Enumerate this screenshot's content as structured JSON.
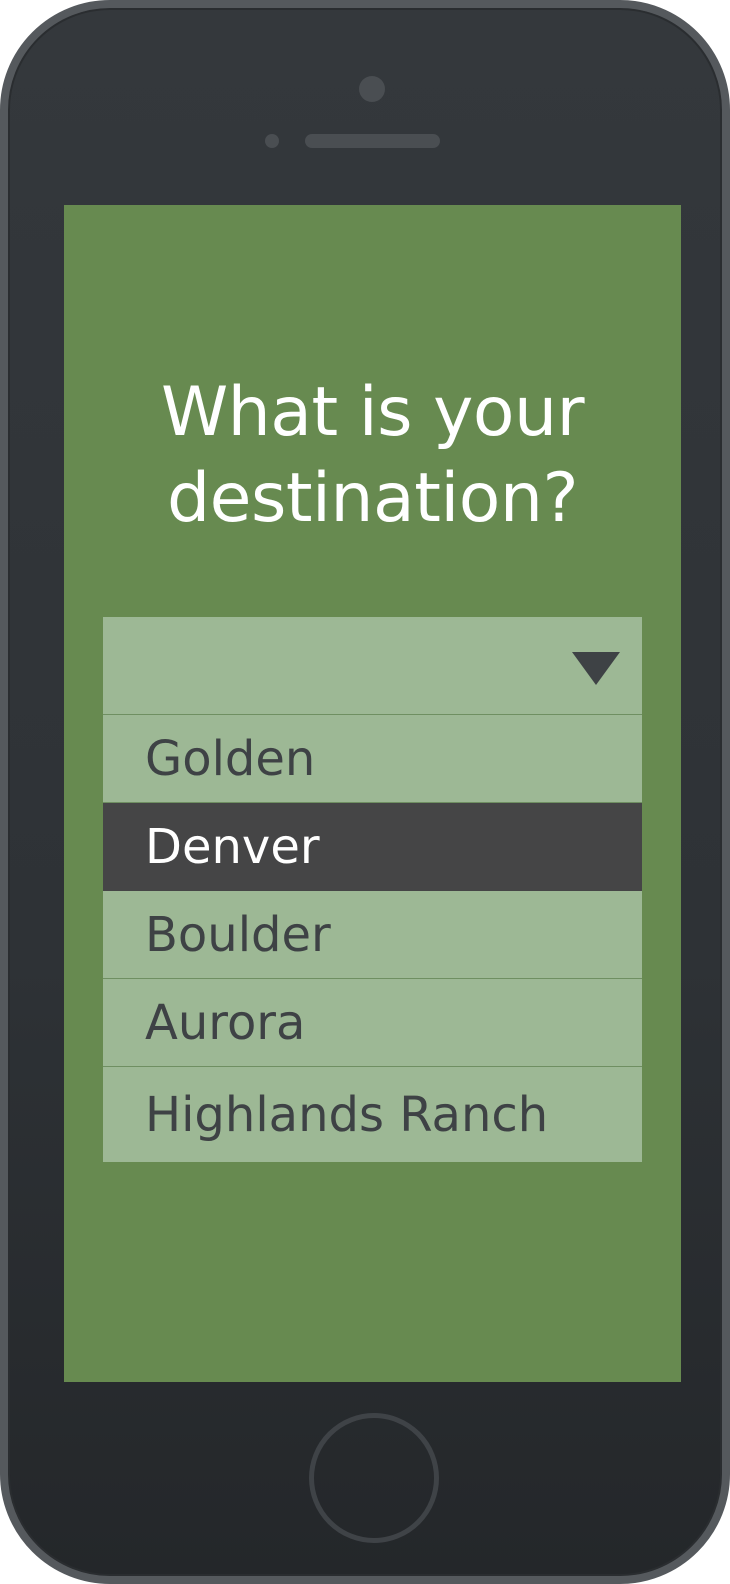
{
  "screen": {
    "question": "What is your destination?",
    "background_color": "#678a50"
  },
  "dropdown": {
    "selected_value": "",
    "options": [
      {
        "label": "Golden"
      },
      {
        "label": "Denver",
        "highlighted": true
      },
      {
        "label": "Boulder"
      },
      {
        "label": "Aurora"
      },
      {
        "label": "Highlands Ranch"
      }
    ],
    "highlight_color": "#454546",
    "background_color": "#9db895",
    "icons": {
      "toggle": "caret-down-icon"
    }
  }
}
